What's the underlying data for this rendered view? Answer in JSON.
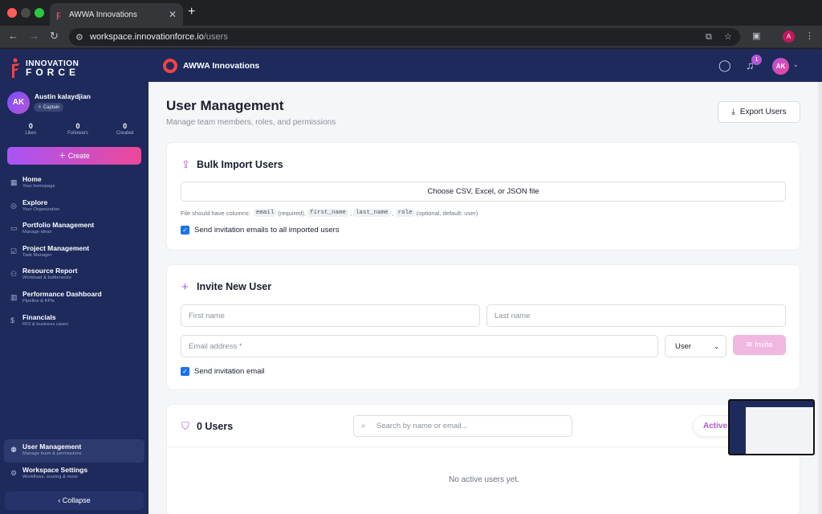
{
  "browser": {
    "tab_title": "AWWA Innovations",
    "url_host": "workspace.innovationforce.io",
    "url_path": "/users",
    "profile_initial": "A"
  },
  "sidebar": {
    "logo_line1": "INNOVATION",
    "logo_line2": "FORCE",
    "user": {
      "initials": "AK",
      "name": "Austin kalaydjian",
      "badge": "Captain",
      "stats": [
        {
          "value": "0",
          "label": "Likes"
        },
        {
          "value": "0",
          "label": "Followers"
        },
        {
          "value": "0",
          "label": "Created"
        }
      ]
    },
    "create_label": "Create",
    "items": [
      {
        "title": "Home",
        "subtitle": "Your homepage",
        "icon": "grid-icon"
      },
      {
        "title": "Explore",
        "subtitle": "Your Organization",
        "icon": "compass-icon"
      },
      {
        "title": "Portfolio Management",
        "subtitle": "Manage ideas",
        "icon": "folder-icon"
      },
      {
        "title": "Project Management",
        "subtitle": "Task Manager",
        "icon": "checkbox-icon"
      },
      {
        "title": "Resource Report",
        "subtitle": "Workload & bottlenecks",
        "icon": "users-icon"
      },
      {
        "title": "Performance Dashboard",
        "subtitle": "Pipeline & KPIs",
        "icon": "bar-chart-icon"
      },
      {
        "title": "Financials",
        "subtitle": "ROI & business cases",
        "icon": "dollar-icon"
      }
    ],
    "bottom_items": [
      {
        "title": "User Management",
        "subtitle": "Manage team & permissions",
        "icon": "user-cog-icon",
        "active": true
      },
      {
        "title": "Workspace Settings",
        "subtitle": "Workflows, scoring & more",
        "icon": "gear-icon",
        "active": false
      }
    ],
    "collapse_label": "Collapse"
  },
  "topbar": {
    "org_name": "AWWA Innovations",
    "notification_count": "1",
    "avatar_initials": "AK"
  },
  "page": {
    "title": "User Management",
    "subtitle": "Manage team members, roles, and permissions",
    "export_label": "Export Users"
  },
  "bulk_import": {
    "title": "Bulk Import Users",
    "file_button": "Choose CSV, Excel, or JSON file",
    "hint_prefix": "File should have columns:",
    "col_email": "email",
    "hint_required": "(required),",
    "col_first": "first_name",
    "col_last": "last_name",
    "col_role": "role",
    "hint_optional": "(optional, default: user)",
    "checkbox_label": "Send invitation emails to all imported users"
  },
  "invite": {
    "title": "Invite New User",
    "first_name_placeholder": "First name",
    "last_name_placeholder": "Last name",
    "email_placeholder": "Email address *",
    "role_value": "User",
    "invite_label": "Invite",
    "checkbox_label": "Send invitation email"
  },
  "users_list": {
    "count_label": "0 Users",
    "search_placeholder": "Search by name or email...",
    "filter_label": "Active",
    "empty_text": "No active users yet."
  },
  "colors": {
    "sidebar_bg": "#1d2a5b",
    "accent_purple": "#b455d6",
    "accent_pink": "#ec4899",
    "brand_red": "#ef4444"
  }
}
